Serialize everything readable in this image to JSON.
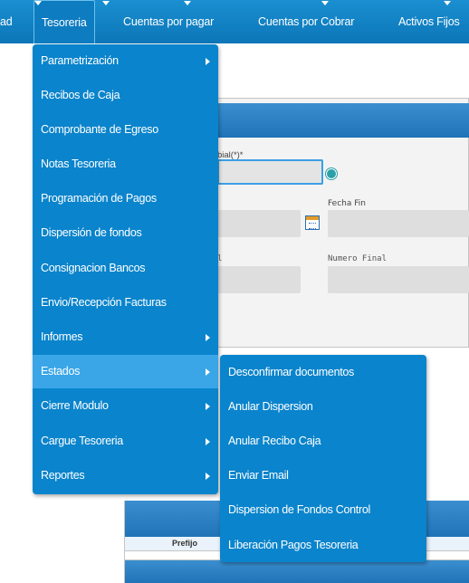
{
  "topnav": {
    "items": [
      {
        "label": "ad"
      },
      {
        "label": "Tesoreria"
      },
      {
        "label": "Cuentas por pagar"
      },
      {
        "label": "Cuentas por Cobrar"
      },
      {
        "label": "Activos Fijos"
      }
    ],
    "active": "Tesoreria"
  },
  "background_form": {
    "field_label_1": "bial(*)*",
    "field_label_2": "Fecha Fin",
    "field_label_3": "l",
    "field_label_4": "Numero Final",
    "table_header": "Prefijo"
  },
  "menu": {
    "items": [
      {
        "label": "Parametrización"
      },
      {
        "label": "Recibos de Caja"
      },
      {
        "label": "Comprobante de Egreso"
      },
      {
        "label": "Notas Tesoreria"
      },
      {
        "label": "Programación de Pagos"
      },
      {
        "label": "Dispersión de fondos"
      },
      {
        "label": "Consignacion Bancos"
      },
      {
        "label": "Envio/Recepción Facturas"
      },
      {
        "label": "Informes"
      },
      {
        "label": "Estados"
      },
      {
        "label": "Cierre Modulo"
      },
      {
        "label": "Cargue Tesoreria"
      },
      {
        "label": "Reportes"
      }
    ],
    "active": "Estados"
  },
  "submenu": {
    "items": [
      {
        "label": "Desconfirmar documentos"
      },
      {
        "label": "Anular Dispersion"
      },
      {
        "label": "Anular Recibo Caja"
      },
      {
        "label": "Enviar Email"
      },
      {
        "label": "Dispersion de Fondos Control"
      },
      {
        "label": "Liberación Pagos Tesoreria"
      }
    ]
  },
  "colors": {
    "menu_bg": "#0a84cc",
    "menu_active": "#3aa6e8",
    "nav_bg": "#0b76b8"
  }
}
